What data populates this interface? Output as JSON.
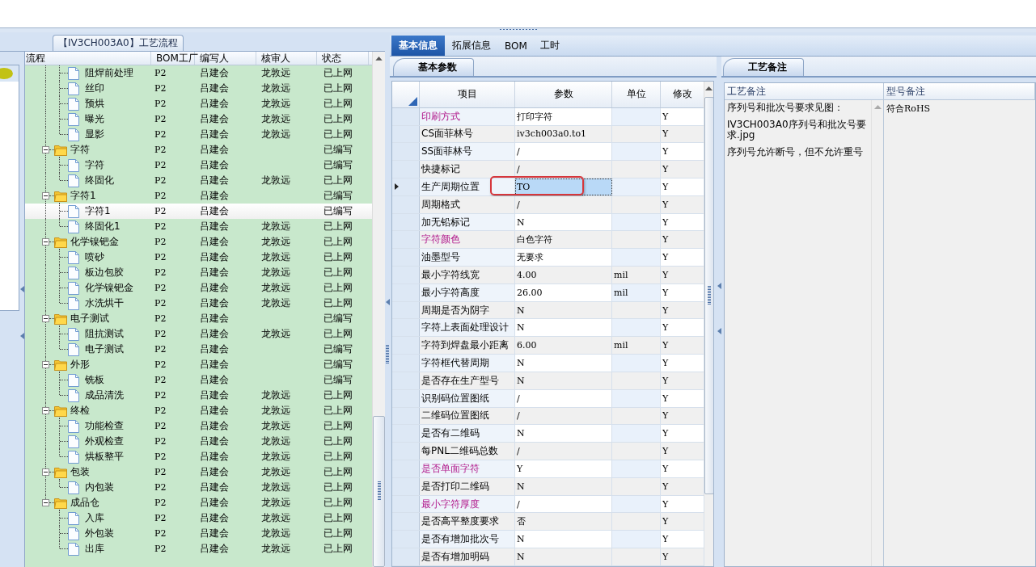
{
  "flow_panel": {
    "title": "【IV3CH003A0】工艺流程",
    "columns": [
      "流程",
      "BOM工厂",
      "编写人",
      "核审人",
      "状态"
    ],
    "tree": [
      {
        "kind": "continuation",
        "children": [
          {
            "kind": "leaf",
            "label": "阻焊前处理",
            "bom": "P2",
            "writer": "吕建会",
            "reviewer": "龙敦远",
            "status": "已上网",
            "selected": false
          },
          {
            "kind": "leaf",
            "label": "丝印",
            "bom": "P2",
            "writer": "吕建会",
            "reviewer": "龙敦远",
            "status": "已上网",
            "selected": false
          },
          {
            "kind": "leaf",
            "label": "预烘",
            "bom": "P2",
            "writer": "吕建会",
            "reviewer": "龙敦远",
            "status": "已上网",
            "selected": false
          },
          {
            "kind": "leaf",
            "label": "曝光",
            "bom": "P2",
            "writer": "吕建会",
            "reviewer": "龙敦远",
            "status": "已上网",
            "selected": false
          },
          {
            "kind": "leaf",
            "label": "显影",
            "bom": "P2",
            "writer": "吕建会",
            "reviewer": "龙敦远",
            "status": "已上网",
            "selected": false
          }
        ]
      },
      {
        "kind": "group",
        "label": "字符",
        "bom": "P2",
        "writer": "吕建会",
        "status": "已编写",
        "expanded": true,
        "selected": false,
        "children": [
          {
            "kind": "leaf",
            "label": "字符",
            "bom": "P2",
            "writer": "吕建会",
            "status": "已编写",
            "selected": false
          },
          {
            "kind": "leaf",
            "label": "终固化",
            "bom": "P2",
            "writer": "吕建会",
            "reviewer": "龙敦远",
            "status": "已上网",
            "selected": false
          }
        ]
      },
      {
        "kind": "group",
        "label": "字符1",
        "bom": "P2",
        "writer": "吕建会",
        "status": "已编写",
        "expanded": true,
        "selected": false,
        "children": [
          {
            "kind": "leaf",
            "label": "字符1",
            "bom": "P2",
            "writer": "吕建会",
            "status": "已编写",
            "selected": true
          },
          {
            "kind": "leaf",
            "label": "终固化1",
            "bom": "P2",
            "writer": "吕建会",
            "reviewer": "龙敦远",
            "status": "已上网",
            "selected": false
          }
        ]
      },
      {
        "kind": "group",
        "label": "化学镍钯金",
        "bom": "P2",
        "writer": "吕建会",
        "reviewer": "龙敦远",
        "status": "已上网",
        "expanded": true,
        "selected": false,
        "children": [
          {
            "kind": "leaf",
            "label": "喷砂",
            "bom": "P2",
            "writer": "吕建会",
            "reviewer": "龙敦远",
            "status": "已上网",
            "selected": false
          },
          {
            "kind": "leaf",
            "label": "板边包胶",
            "bom": "P2",
            "writer": "吕建会",
            "reviewer": "龙敦远",
            "status": "已上网",
            "selected": false
          },
          {
            "kind": "leaf",
            "label": "化学镍钯金",
            "bom": "P2",
            "writer": "吕建会",
            "reviewer": "龙敦远",
            "status": "已上网",
            "selected": false
          },
          {
            "kind": "leaf",
            "label": "水洗烘干",
            "bom": "P2",
            "writer": "吕建会",
            "reviewer": "龙敦远",
            "status": "已上网",
            "selected": false
          }
        ]
      },
      {
        "kind": "group",
        "label": "电子测试",
        "bom": "P2",
        "writer": "吕建会",
        "status": "已编写",
        "expanded": true,
        "selected": false,
        "children": [
          {
            "kind": "leaf",
            "label": "阻抗测试",
            "bom": "P2",
            "writer": "吕建会",
            "reviewer": "龙敦远",
            "status": "已上网",
            "selected": false
          },
          {
            "kind": "leaf",
            "label": "电子测试",
            "bom": "P2",
            "writer": "吕建会",
            "status": "已编写",
            "selected": false
          }
        ]
      },
      {
        "kind": "group",
        "label": "外形",
        "bom": "P2",
        "writer": "吕建会",
        "status": "已编写",
        "expanded": true,
        "selected": false,
        "children": [
          {
            "kind": "leaf",
            "label": "铣板",
            "bom": "P2",
            "writer": "吕建会",
            "status": "已编写",
            "selected": false
          },
          {
            "kind": "leaf",
            "label": "成品清洗",
            "bom": "P2",
            "writer": "吕建会",
            "reviewer": "龙敦远",
            "status": "已上网",
            "selected": false
          }
        ]
      },
      {
        "kind": "group",
        "label": "终检",
        "bom": "P2",
        "writer": "吕建会",
        "reviewer": "龙敦远",
        "status": "已上网",
        "expanded": true,
        "selected": false,
        "children": [
          {
            "kind": "leaf",
            "label": "功能检查",
            "bom": "P2",
            "writer": "吕建会",
            "reviewer": "龙敦远",
            "status": "已上网",
            "selected": false
          },
          {
            "kind": "leaf",
            "label": "外观检查",
            "bom": "P2",
            "writer": "吕建会",
            "reviewer": "龙敦远",
            "status": "已上网",
            "selected": false
          },
          {
            "kind": "leaf",
            "label": "烘板整平",
            "bom": "P2",
            "writer": "吕建会",
            "reviewer": "龙敦远",
            "status": "已上网",
            "selected": false
          }
        ]
      },
      {
        "kind": "group",
        "label": "包装",
        "bom": "P2",
        "writer": "吕建会",
        "reviewer": "龙敦远",
        "status": "已上网",
        "expanded": true,
        "selected": false,
        "children": [
          {
            "kind": "leaf",
            "label": "内包装",
            "bom": "P2",
            "writer": "吕建会",
            "reviewer": "龙敦远",
            "status": "已上网",
            "selected": false
          }
        ]
      },
      {
        "kind": "group",
        "label": "成品仓",
        "bom": "P2",
        "writer": "吕建会",
        "reviewer": "龙敦远",
        "status": "已上网",
        "expanded": true,
        "selected": false,
        "children": [
          {
            "kind": "leaf",
            "label": "入库",
            "bom": "P2",
            "writer": "吕建会",
            "reviewer": "龙敦远",
            "status": "已上网",
            "selected": false
          },
          {
            "kind": "leaf",
            "label": "外包装",
            "bom": "P2",
            "writer": "吕建会",
            "reviewer": "龙敦远",
            "status": "已上网",
            "selected": false
          },
          {
            "kind": "leaf",
            "label": "出库",
            "bom": "P2",
            "writer": "吕建会",
            "reviewer": "龙敦远",
            "status": "已上网",
            "selected": false
          }
        ]
      }
    ]
  },
  "detail_tabs": [
    {
      "label": "基本信息",
      "selected": true
    },
    {
      "label": "拓展信息",
      "selected": false
    },
    {
      "label": "BOM",
      "selected": false
    },
    {
      "label": "工时",
      "selected": false
    }
  ],
  "params_panel": {
    "tab": "基本参数",
    "columns": [
      "项目",
      "参数",
      "单位",
      "修改"
    ],
    "rows": [
      {
        "item": "印刷方式",
        "value": "打印字符",
        "modify": "Y",
        "emphasized": true,
        "current": false,
        "annotated": false
      },
      {
        "item": "CS面菲林号",
        "value": "iv3ch003a0.to1",
        "modify": "Y",
        "emphasized": false,
        "current": false,
        "annotated": false
      },
      {
        "item": "SS面菲林号",
        "value": "/",
        "modify": "Y",
        "emphasized": false,
        "current": false,
        "annotated": false
      },
      {
        "item": "快捷标记",
        "value": "/",
        "modify": "Y",
        "emphasized": false,
        "current": false,
        "annotated": false
      },
      {
        "item": "生产周期位置",
        "value": "TO",
        "modify": "Y",
        "emphasized": false,
        "current": true,
        "annotated": true
      },
      {
        "item": "周期格式",
        "value": "/",
        "modify": "Y",
        "emphasized": false,
        "current": false,
        "annotated": false
      },
      {
        "item": "加无铅标记",
        "value": "N",
        "modify": "Y",
        "emphasized": false,
        "current": false,
        "annotated": false
      },
      {
        "item": "字符颜色",
        "value": "白色字符",
        "modify": "Y",
        "emphasized": true,
        "current": false,
        "annotated": false
      },
      {
        "item": "油墨型号",
        "value": "无要求",
        "modify": "Y",
        "emphasized": false,
        "current": false,
        "annotated": false
      },
      {
        "item": "最小字符线宽",
        "value": "4.00",
        "unit": "mil",
        "modify": "Y",
        "emphasized": false,
        "current": false,
        "annotated": false
      },
      {
        "item": "最小字符高度",
        "value": "26.00",
        "unit": "mil",
        "modify": "Y",
        "emphasized": false,
        "current": false,
        "annotated": false
      },
      {
        "item": "周期是否为阴字",
        "value": "N",
        "modify": "Y",
        "emphasized": false,
        "current": false,
        "annotated": false
      },
      {
        "item": "字符上表面处理设计",
        "value": "N",
        "modify": "Y",
        "emphasized": false,
        "current": false,
        "annotated": false
      },
      {
        "item": "字符到焊盘最小距离",
        "value": "6.00",
        "unit": "mil",
        "modify": "Y",
        "emphasized": false,
        "current": false,
        "annotated": false
      },
      {
        "item": "字符框代替周期",
        "value": "N",
        "modify": "Y",
        "emphasized": false,
        "current": false,
        "annotated": false
      },
      {
        "item": "是否存在生产型号",
        "value": "N",
        "modify": "Y",
        "emphasized": false,
        "current": false,
        "annotated": false
      },
      {
        "item": "识别码位置图纸",
        "value": "/",
        "modify": "Y",
        "emphasized": false,
        "current": false,
        "annotated": false
      },
      {
        "item": "二维码位置图纸",
        "value": "/",
        "modify": "Y",
        "emphasized": false,
        "current": false,
        "annotated": false
      },
      {
        "item": "是否有二维码",
        "value": "N",
        "modify": "Y",
        "emphasized": false,
        "current": false,
        "annotated": false
      },
      {
        "item": "每PNL二维码总数",
        "value": "/",
        "modify": "Y",
        "emphasized": false,
        "current": false,
        "annotated": false
      },
      {
        "item": "是否单面字符",
        "value": "Y",
        "modify": "Y",
        "emphasized": true,
        "current": false,
        "annotated": false
      },
      {
        "item": "是否打印二维码",
        "value": "N",
        "modify": "Y",
        "emphasized": false,
        "current": false,
        "annotated": false
      },
      {
        "item": "最小字符厚度",
        "value": "/",
        "modify": "Y",
        "emphasized": true,
        "current": false,
        "annotated": false
      },
      {
        "item": "是否高平整度要求",
        "value": "否",
        "modify": "Y",
        "emphasized": false,
        "current": false,
        "annotated": false
      },
      {
        "item": "是否有增加批次号",
        "value": "N",
        "modify": "Y",
        "emphasized": false,
        "current": false,
        "annotated": false
      },
      {
        "item": "是否有增加明码",
        "value": "N",
        "modify": "Y",
        "emphasized": false,
        "current": false,
        "annotated": false
      }
    ]
  },
  "notes_panel": {
    "tab": "工艺备注",
    "columns": [
      "工艺备注",
      "型号备注"
    ],
    "process_notes": [
      "序列号和批次号要求见图：",
      "IV3CH003A0序列号和批次号要求.jpg",
      "序列号允许断号，但不允许重号"
    ],
    "model_notes": "符合RoHS"
  }
}
